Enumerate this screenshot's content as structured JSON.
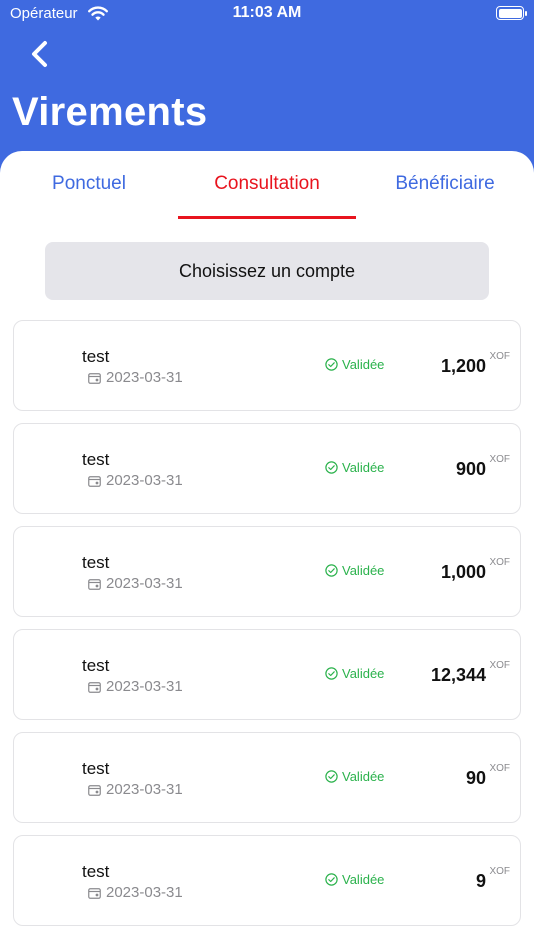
{
  "status_bar": {
    "carrier": "Opérateur",
    "time": "11:03 AM"
  },
  "header": {
    "title": "Virements"
  },
  "tabs": [
    {
      "label": "Ponctuel",
      "active": false
    },
    {
      "label": "Consultation",
      "active": true
    },
    {
      "label": "Bénéficiaire",
      "active": false
    }
  ],
  "account_selector": {
    "label": "Choisissez un compte"
  },
  "transactions": [
    {
      "name": "test",
      "date": "2023-03-31",
      "status": "Validée",
      "amount": "1,200",
      "currency": "XOF"
    },
    {
      "name": "test",
      "date": "2023-03-31",
      "status": "Validée",
      "amount": "900",
      "currency": "XOF"
    },
    {
      "name": "test",
      "date": "2023-03-31",
      "status": "Validée",
      "amount": "1,000",
      "currency": "XOF"
    },
    {
      "name": "test",
      "date": "2023-03-31",
      "status": "Validée",
      "amount": "12,344",
      "currency": "XOF"
    },
    {
      "name": "test",
      "date": "2023-03-31",
      "status": "Validée",
      "amount": "90",
      "currency": "XOF"
    },
    {
      "name": "test",
      "date": "2023-03-31",
      "status": "Validée",
      "amount": "9",
      "currency": "XOF"
    }
  ],
  "colors": {
    "primary": "#3f6ae0",
    "active_tab": "#e8141e",
    "status_ok": "#2bb24c",
    "selector_bg": "#e5e5ea"
  },
  "icons": {
    "back": "chevron-left-icon",
    "wifi": "wifi-icon",
    "battery": "battery-icon",
    "date": "calendar-icon",
    "status": "check-circle-icon"
  }
}
